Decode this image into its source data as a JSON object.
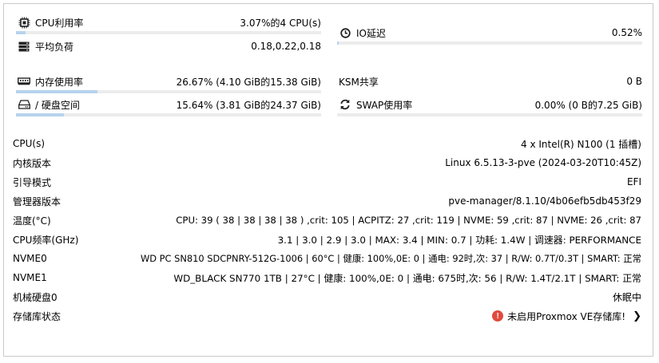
{
  "stats": {
    "cpu": {
      "label": "CPU利用率",
      "value": "3.07%的4 CPU(s)",
      "percent": 3.07,
      "icon": "cpu-chip-icon"
    },
    "load": {
      "label": "平均负荷",
      "value": "0.18,0.22,0.18",
      "icon": "server-icon"
    },
    "io": {
      "label": "IO延迟",
      "value": "0.52%",
      "percent": 0.52,
      "icon": "clock-icon"
    },
    "mem": {
      "label": "内存使用率",
      "value": "26.67% (4.10 GiB的15.38 GiB)",
      "percent": 26.67,
      "icon": "memory-icon"
    },
    "disk": {
      "label": "/ 硬盘空间",
      "value": "15.64% (3.81 GiB的24.37 GiB)",
      "percent": 15.64,
      "icon": "hdd-icon"
    },
    "ksm": {
      "label": "KSM共享",
      "value": "0 B"
    },
    "swap": {
      "label": "SWAP使用率",
      "value": "0.00% (0 B的7.25 GiB)",
      "percent": 0.0,
      "icon": "refresh-icon"
    }
  },
  "info": [
    {
      "key": "CPU(s)",
      "value": "4 x Intel(R) N100 (1 插槽)"
    },
    {
      "key": "内核版本",
      "value": "Linux 6.5.13-3-pve (2024-03-20T10:45Z)"
    },
    {
      "key": "引导模式",
      "value": "EFI"
    },
    {
      "key": "管理器版本",
      "value": "pve-manager/8.1.10/4b06efb5db453f29"
    },
    {
      "key": "温度(°C)",
      "value": "CPU: 39 ( 38 | 38 | 38 | 38 ) ,crit: 105 | ACPITZ: 27 ,crit: 119 | NVME: 59 ,crit: 87 | NVME: 26 ,crit: 87"
    },
    {
      "key": "CPU频率(GHz)",
      "value": "3.1 | 3.0 | 2.9 | 3.0 | MAX: 3.4 | MIN: 0.7 | 功耗: 1.4W | 调速器: PERFORMANCE"
    },
    {
      "key": "NVME0",
      "value": "WD PC SN810 SDCPNRY-512G-1006 | 60°C | 健康: 100%,0E: 0 | 通电: 92时,次: 37 | R/W: 0.7T/0.3T | SMART: 正常"
    },
    {
      "key": "NVME1",
      "value": "WD_BLACK SN770 1TB | 27°C | 健康: 100%,0E: 0 | 通电: 675时,次: 56 | R/W: 1.4T/2.1T | SMART: 正常"
    },
    {
      "key": "机械硬盘0",
      "value": "休眠中"
    }
  ],
  "repo": {
    "key": "存储库状态",
    "value": "未启用Proxmox VE存储库!",
    "icon": "error-circle-icon",
    "chevron": "chevron-right-icon"
  },
  "colors": {
    "bar_fill": "#b7d3ec",
    "bar_track": "#ececec",
    "error": "#e04b3d"
  }
}
